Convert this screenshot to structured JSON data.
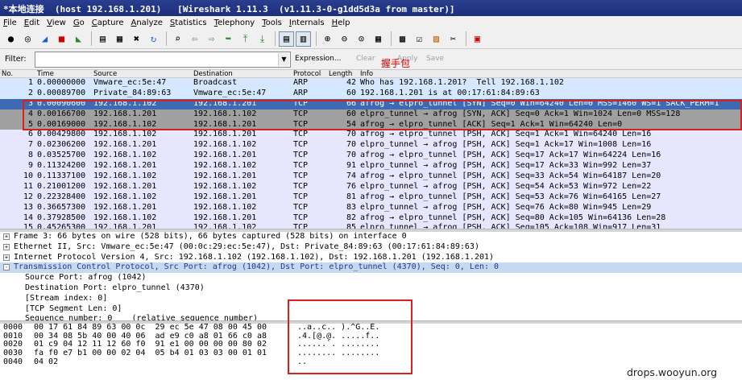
{
  "window": {
    "title": "*本地连接  (host 192.168.1.201)   [Wireshark 1.11.3  (v1.11.3-0-g1dd5d3a from master)]"
  },
  "menu": [
    "File",
    "Edit",
    "View",
    "Go",
    "Capture",
    "Analyze",
    "Statistics",
    "Telephony",
    "Tools",
    "Internals",
    "Help"
  ],
  "filter": {
    "label": "Filter:",
    "value": "",
    "expression": "Expression...",
    "clear": "Clear",
    "apply": "Apply",
    "save": "Save"
  },
  "annotation": "握手包",
  "columns": {
    "no": "No.",
    "time": "Time",
    "source": "Source",
    "destination": "Destination",
    "protocol": "Protocol",
    "length": "Length",
    "info": "Info"
  },
  "packets": [
    {
      "no": "1",
      "time": "0.00000000",
      "src": "Vmware_ec:5e:47",
      "dst": "Broadcast",
      "proto": "ARP",
      "len": "42",
      "info": "Who has 192.168.1.201?  Tell 192.168.1.102"
    },
    {
      "no": "2",
      "time": "0.00089700",
      "src": "Private_84:89:63",
      "dst": "Vmware_ec:5e:47",
      "proto": "ARP",
      "len": "60",
      "info": "192.168.1.201 is at 00:17:61:84:89:63"
    },
    {
      "no": "3",
      "time": "0.00090600",
      "src": "192.168.1.102",
      "dst": "192.168.1.201",
      "proto": "TCP",
      "len": "66",
      "info": "afrog → elpro_tunnel [SYN] Seq=0 Win=64240 Len=0 MSS=1460 WS=1 SACK_PERM=1"
    },
    {
      "no": "4",
      "time": "0.00166700",
      "src": "192.168.1.201",
      "dst": "192.168.1.102",
      "proto": "TCP",
      "len": "60",
      "info": "elpro_tunnel → afrog [SYN, ACK] Seq=0 Ack=1 Win=1024 Len=0 MSS=128"
    },
    {
      "no": "5",
      "time": "0.00169000",
      "src": "192.168.1.102",
      "dst": "192.168.1.201",
      "proto": "TCP",
      "len": "54",
      "info": "afrog → elpro_tunnel [ACK] Seq=1 Ack=1 Win=64240 Len=0"
    },
    {
      "no": "6",
      "time": "0.00429800",
      "src": "192.168.1.102",
      "dst": "192.168.1.201",
      "proto": "TCP",
      "len": "70",
      "info": "afrog → elpro_tunnel [PSH, ACK] Seq=1 Ack=1 Win=64240 Len=16"
    },
    {
      "no": "7",
      "time": "0.02306200",
      "src": "192.168.1.201",
      "dst": "192.168.1.102",
      "proto": "TCP",
      "len": "70",
      "info": "elpro_tunnel → afrog [PSH, ACK] Seq=1 Ack=17 Win=1008 Len=16"
    },
    {
      "no": "8",
      "time": "0.03525700",
      "src": "192.168.1.102",
      "dst": "192.168.1.201",
      "proto": "TCP",
      "len": "70",
      "info": "afrog → elpro_tunnel [PSH, ACK] Seq=17 Ack=17 Win=64224 Len=16"
    },
    {
      "no": "9",
      "time": "0.11324200",
      "src": "192.168.1.201",
      "dst": "192.168.1.102",
      "proto": "TCP",
      "len": "91",
      "info": "elpro_tunnel → afrog [PSH, ACK] Seq=17 Ack=33 Win=992 Len=37"
    },
    {
      "no": "10",
      "time": "0.11337100",
      "src": "192.168.1.102",
      "dst": "192.168.1.201",
      "proto": "TCP",
      "len": "74",
      "info": "afrog → elpro_tunnel [PSH, ACK] Seq=33 Ack=54 Win=64187 Len=20"
    },
    {
      "no": "11",
      "time": "0.21001200",
      "src": "192.168.1.201",
      "dst": "192.168.1.102",
      "proto": "TCP",
      "len": "76",
      "info": "elpro_tunnel → afrog [PSH, ACK] Seq=54 Ack=53 Win=972 Len=22"
    },
    {
      "no": "12",
      "time": "0.22328400",
      "src": "192.168.1.102",
      "dst": "192.168.1.201",
      "proto": "TCP",
      "len": "81",
      "info": "afrog → elpro_tunnel [PSH, ACK] Seq=53 Ack=76 Win=64165 Len=27"
    },
    {
      "no": "13",
      "time": "0.36657300",
      "src": "192.168.1.201",
      "dst": "192.168.1.102",
      "proto": "TCP",
      "len": "83",
      "info": "elpro_tunnel → afrog [PSH, ACK] Seq=76 Ack=80 Win=945 Len=29"
    },
    {
      "no": "14",
      "time": "0.37928500",
      "src": "192.168.1.102",
      "dst": "192.168.1.201",
      "proto": "TCP",
      "len": "82",
      "info": "afrog → elpro_tunnel [PSH, ACK] Seq=80 Ack=105 Win=64136 Len=28"
    },
    {
      "no": "15",
      "time": "0.45265300",
      "src": "192.168.1.201",
      "dst": "192.168.1.102",
      "proto": "TCP",
      "len": "85",
      "info": "elpro_tunnel → afrog [PSH, ACK] Seq=105 Ack=108 Win=917 Len=31"
    }
  ],
  "details": [
    {
      "text": "Frame 3: 66 bytes on wire (528 bits), 66 bytes captured (528 bits) on interface 0",
      "expander": "+"
    },
    {
      "text": "Ethernet II, Src: Vmware_ec:5e:47 (00:0c:29:ec:5e:47), Dst: Private_84:89:63 (00:17:61:84:89:63)",
      "expander": "+"
    },
    {
      "text": "Internet Protocol Version 4, Src: 192.168.1.102 (192.168.1.102), Dst: 192.168.1.201 (192.168.1.201)",
      "expander": "+"
    },
    {
      "text": "Transmission Control Protocol, Src Port: afrog (1042), Dst Port: elpro_tunnel (4370), Seq: 0, Len: 0",
      "expander": "-"
    }
  ],
  "tcp_fields": [
    "Source Port: afrog (1042)",
    "Destination Port: elpro_tunnel (4370)",
    "[Stream index: 0]",
    "[TCP Segment Len: 0]",
    "Sequence number: 0    (relative sequence number)"
  ],
  "bytes": [
    {
      "off": "0000",
      "hex": "00 17 61 84 89 63 00 0c  29 ec 5e 47 08 00 45 00",
      "ascii": "..a..c.. ).^G..E."
    },
    {
      "off": "0010",
      "hex": "00 34 08 5b 40 00 40 06  ad e9 c0 a8 01 66 c0 a8",
      "ascii": ".4.[@.@. .....f.."
    },
    {
      "off": "0020",
      "hex": "01 c9 04 12 11 12 60 f0  91 e1 00 00 00 00 80 02",
      "ascii": "......`. ........"
    },
    {
      "off": "0030",
      "hex": "fa f0 e7 b1 00 00 02 04  05 b4 01 03 03 00 01 01",
      "ascii": "........ ........"
    },
    {
      "off": "0040",
      "hex": "04 02",
      "ascii": ".."
    }
  ],
  "watermark": "drops.wooyun.org",
  "colors": {
    "selected_row": "#3e69b3",
    "tcp_row": "#e7e6ff",
    "arp_row": "#d6e8ff",
    "highlight": "#d8201c",
    "grey_row": "#a0a0a0"
  }
}
